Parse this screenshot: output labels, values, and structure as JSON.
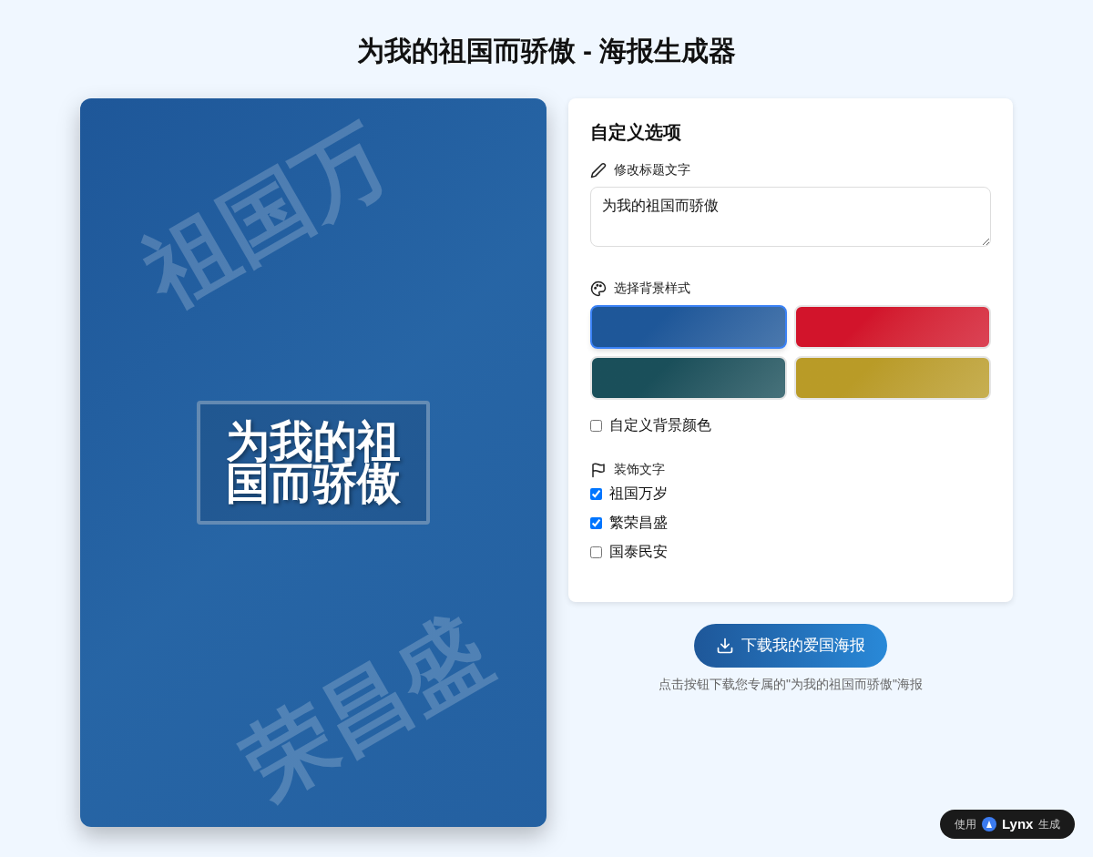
{
  "page_title": "为我的祖国而骄傲 - 海报生成器",
  "poster": {
    "watermarks": [
      "祖国万",
      "荣昌盛"
    ],
    "headline": "为我的祖国而骄傲"
  },
  "options": {
    "heading": "自定义选项",
    "title_section": {
      "label": "修改标题文字",
      "value": "为我的祖国而骄傲"
    },
    "background_section": {
      "label": "选择背景样式",
      "swatches": [
        {
          "color": "#1e5799",
          "selected": true
        },
        {
          "color": "#d2142b",
          "selected": false
        },
        {
          "color": "#1a4f5a",
          "selected": false
        },
        {
          "color": "#b99b27",
          "selected": false
        }
      ],
      "custom_color": {
        "label": "自定义背景颜色",
        "checked": false
      }
    },
    "decor_section": {
      "label": "装饰文字",
      "items": [
        {
          "label": "祖国万岁",
          "checked": true
        },
        {
          "label": "繁荣昌盛",
          "checked": true
        },
        {
          "label": "国泰民安",
          "checked": false
        }
      ]
    }
  },
  "download": {
    "button": "下载我的爱国海报",
    "caption": "点击按钮下载您专属的\"为我的祖国而骄傲\"海报"
  },
  "badge": {
    "prefix": "使用",
    "brand": "Lynx",
    "suffix": "生成"
  }
}
